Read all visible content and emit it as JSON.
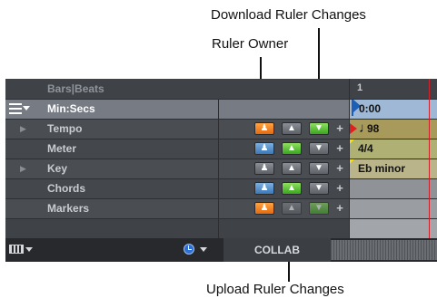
{
  "callouts": {
    "download": "Download Ruler Changes",
    "owner": "Ruler Owner",
    "upload": "Upload Ruler Changes"
  },
  "rulers": {
    "bars_beats": {
      "label": "Bars|Beats",
      "timeline": "1"
    },
    "min_secs": {
      "label": "Min:Secs",
      "timeline": "0:00"
    },
    "tempo": {
      "label": "Tempo",
      "timeline": "98"
    },
    "meter": {
      "label": "Meter",
      "timeline": "4/4"
    },
    "key": {
      "label": "Key",
      "timeline": "Eb minor"
    },
    "chords": {
      "label": "Chords"
    },
    "markers": {
      "label": "Markers"
    }
  },
  "bottom": {
    "collab_label": "COLLAB"
  },
  "colors": {
    "panel": "#3d4045",
    "owner_orange": "#e46a10",
    "owner_blue": "#3a78b8",
    "download_green": "#3aa520",
    "tempo_lane": "#a79a5a",
    "meter_lane": "#aeb074",
    "key_lane": "#b9b48a",
    "playhead": "#d0202a"
  }
}
